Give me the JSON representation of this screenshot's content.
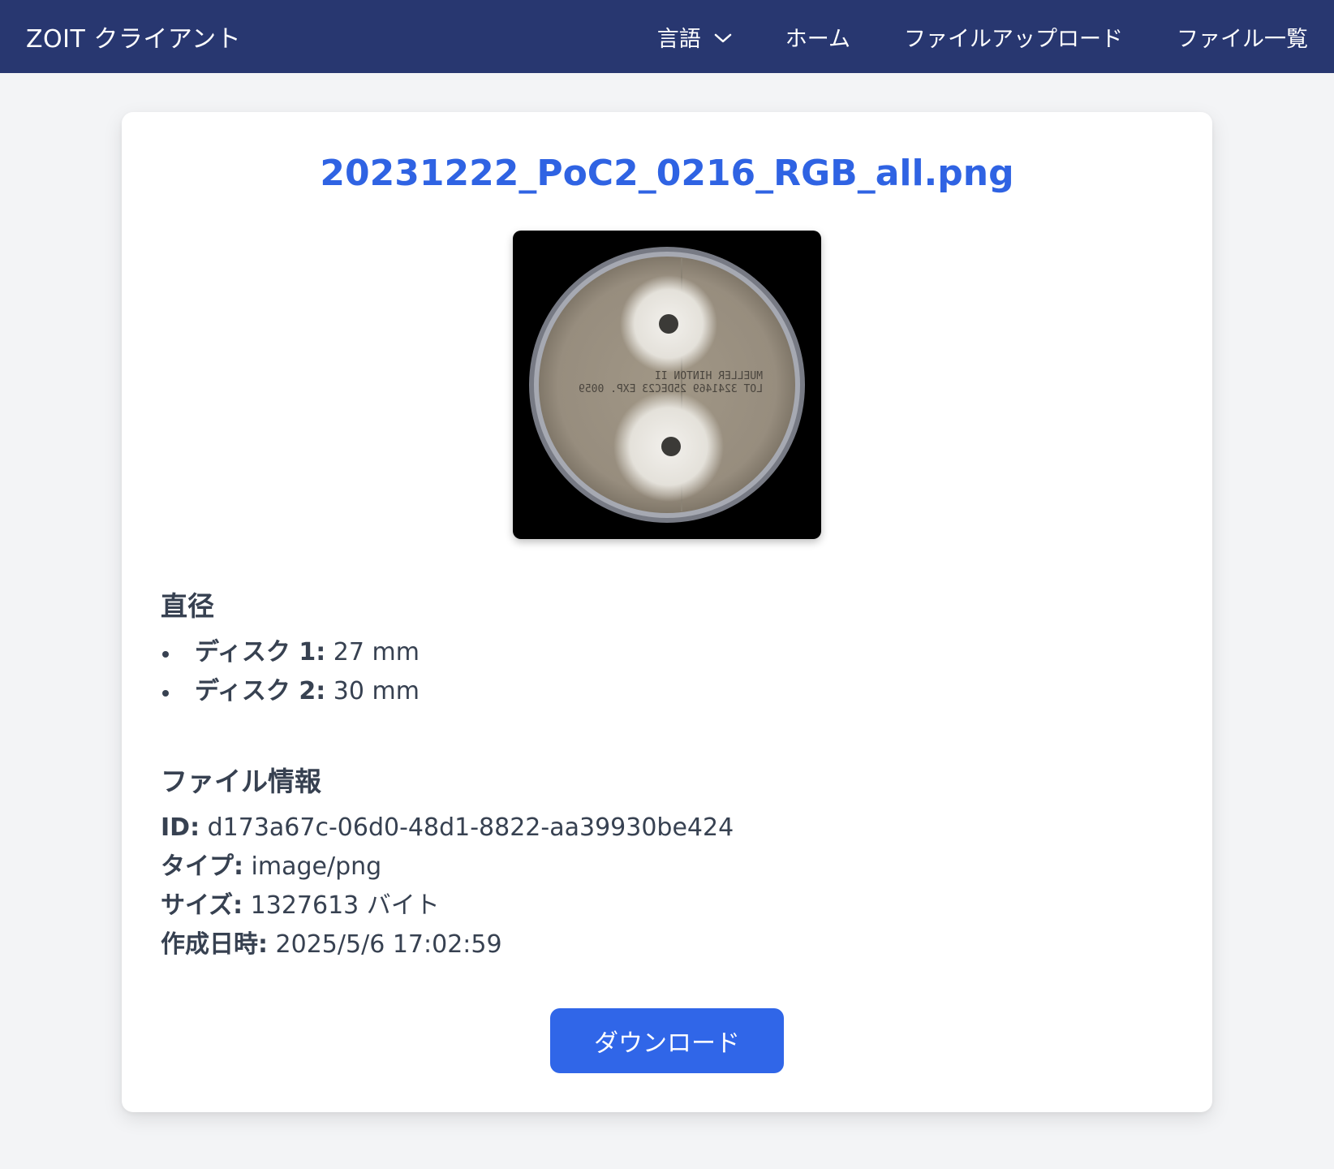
{
  "nav": {
    "brand": "ZOIT クライアント",
    "language": "言語",
    "home": "ホーム",
    "upload": "ファイルアップロード",
    "files": "ファイル一覧"
  },
  "file": {
    "name": "20231222_PoC2_0216_RGB_all.png",
    "plate_text_line1": "MUELLER HINTON II",
    "plate_text_line2": "LOT 3241469 25DEC23 EXP. 0059"
  },
  "diameter": {
    "heading": "直径",
    "items": [
      {
        "label": "ディスク 1:",
        "value": "27 mm"
      },
      {
        "label": "ディスク 2:",
        "value": "30 mm"
      }
    ]
  },
  "info": {
    "heading": "ファイル情報",
    "id_label": "ID:",
    "id_value": "d173a67c-06d0-48d1-8822-aa39930be424",
    "type_label": "タイプ:",
    "type_value": "image/png",
    "size_label": "サイズ:",
    "size_value": "1327613 バイト",
    "created_label": "作成日時:",
    "created_value": "2025/5/6 17:02:59"
  },
  "download_label": "ダウンロード",
  "colors": {
    "navbar": "#283770",
    "title": "#2f63e3",
    "button": "#3066e8",
    "background": "#f3f4f6"
  }
}
